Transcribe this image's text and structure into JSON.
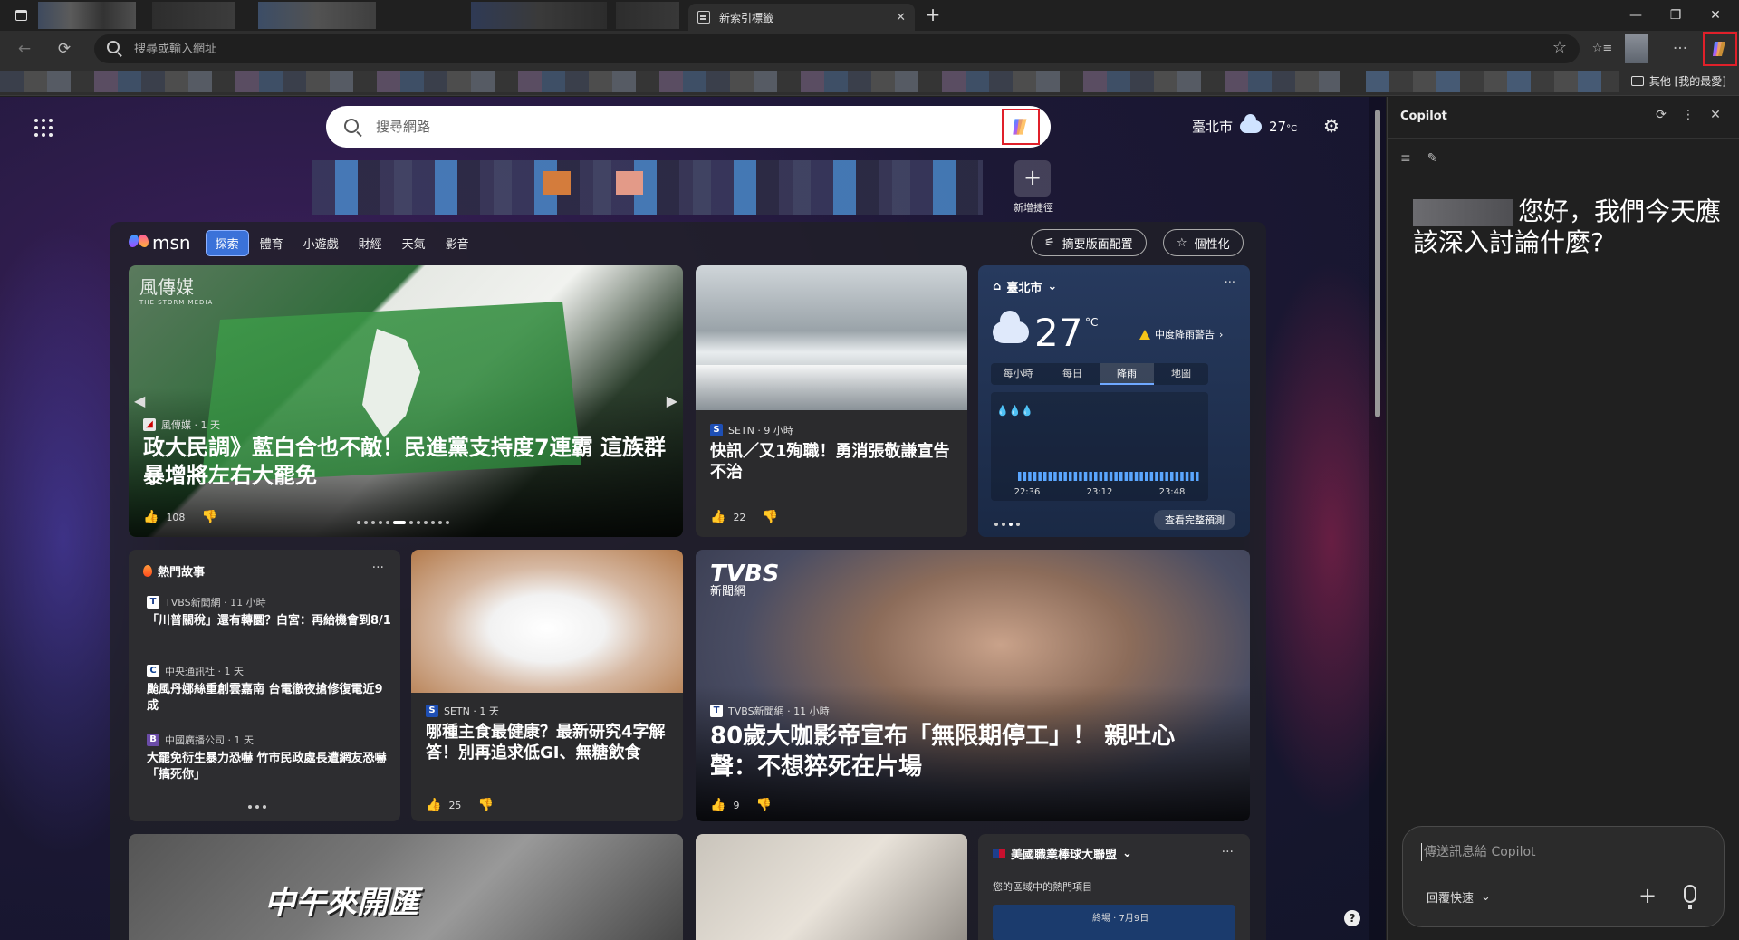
{
  "tabstrip": {
    "active_tab_title": "新索引標籤",
    "close_glyph": "✕",
    "new_tab_glyph": "+",
    "window": {
      "minimize": "—",
      "restore": "❐",
      "close": "✕"
    }
  },
  "toolbar": {
    "back_glyph": "←",
    "refresh_glyph": "⟳",
    "address_placeholder": "搜尋或輸入網址",
    "star_glyph": "☆",
    "favorites_glyph": "☆≡",
    "more_glyph": "···"
  },
  "favorites_bar": {
    "other_favorites": "其他 [我的最愛]"
  },
  "ntp": {
    "search_placeholder": "搜尋網路",
    "weather": {
      "city": "臺北市",
      "temp": "27",
      "unit": "°C"
    },
    "add_shortcut_label": "新增捷徑",
    "add_shortcut_glyph": "+",
    "settings_glyph": "⚙",
    "help_glyph": "?"
  },
  "feed": {
    "logo_text": "msn",
    "nav_tabs": [
      "探索",
      "體育",
      "小遊戲",
      "財經",
      "天氣",
      "影音"
    ],
    "layout_button": "摘要版面配置",
    "personalize_button": "個性化",
    "hero": {
      "watermark": "風傳媒",
      "watermark_sub": "THE STORM MEDIA",
      "source": "風傳媒 · 1 天",
      "headline": "政大民調》藍白合也不敵！民進黨支持度7連霸 這族群暴增將左右大罷免",
      "likes": "108"
    },
    "story2": {
      "source": "SETN · 9 小時",
      "headline": "快訊／又1殉職！勇消張敬謙宣告不治",
      "likes": "22"
    },
    "weather_card": {
      "location": "臺北市",
      "temp": "27",
      "unit": "°C",
      "alert": "中度降雨警告",
      "tabs": [
        "每小時",
        "每日",
        "降雨",
        "地圖"
      ],
      "ticks": [
        "22:36",
        "23:12",
        "23:48"
      ],
      "more": "查看完整預測"
    },
    "trending": {
      "title": "熱門故事",
      "items": [
        {
          "source": "TVBS新聞網 · 11 小時",
          "headline": "「川普關稅」還有轉圜？白宮：再給機會到8/1"
        },
        {
          "source": "中央通訊社 · 1 天",
          "headline": "颱風丹娜絲重創雲嘉南 台電徹夜搶修復電近9成"
        },
        {
          "source": "中國廣播公司 · 1 天",
          "headline": "大罷免衍生暴力恐嚇 竹市民政處長遭網友恐嚇「搞死你」"
        }
      ]
    },
    "rice": {
      "source": "SETN · 1 天",
      "headline": "哪種主食最健康？最新研究4字解答！別再追求低GI、無糖飲食",
      "likes": "25"
    },
    "tvbs": {
      "logo": "TVBS",
      "logo_sub": "新聞網",
      "source": "TVBS新聞網 · 11 小時",
      "headline": "80歲大咖影帝宣布「無限期停工」！ 親吐心聲：不想猝死在片場",
      "likes": "9"
    },
    "bottom_left_text": "中午來開匯",
    "mlb": {
      "title": "美國職業棒球大聯盟",
      "subtitle": "您的區域中的熱門項目",
      "score_label": "終場 · 7月9日"
    }
  },
  "copilot": {
    "title": "Copilot",
    "greeting": "您好，我們今天應該深入討論什麼?",
    "input_placeholder": "傳送訊息給 Copilot",
    "mode_label": "回覆快速",
    "plus_glyph": "+"
  },
  "colors": {
    "highlight_red": "#e0202a",
    "nav_active": "#3b72d9",
    "toolbar_bg": "#2e2e2e"
  }
}
